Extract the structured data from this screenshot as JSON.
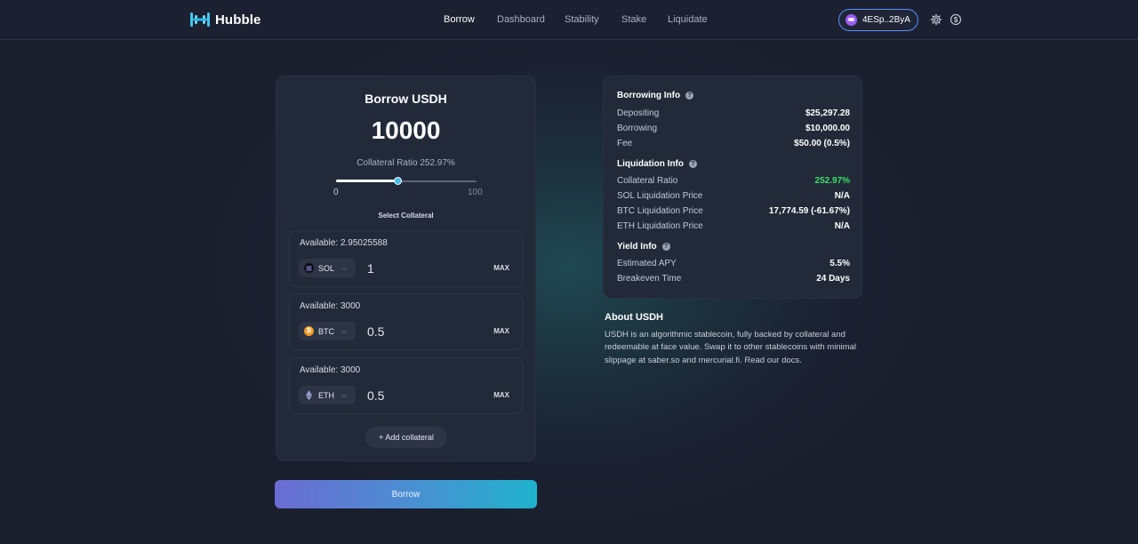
{
  "header": {
    "logo_text": "Hubble",
    "nav": [
      {
        "label": "Borrow",
        "active": true
      },
      {
        "label": "Dashboard",
        "active": false
      },
      {
        "label": "Stability",
        "active": false
      },
      {
        "label": "Stake",
        "active": false
      },
      {
        "label": "Liquidate",
        "active": false
      }
    ],
    "wallet": "4ESp..2ByA",
    "icons": [
      "gear-icon",
      "dollar-icon"
    ]
  },
  "borrow": {
    "title": "Borrow USDH",
    "amount": "10000",
    "ratio_label": "Collateral Ratio 252.97%",
    "slider": {
      "min_label": "0",
      "max_label": "100",
      "value": 44
    },
    "select_collateral": "Select Collateral",
    "collaterals": [
      {
        "available": "Available: 2.95025588",
        "token": "SOL",
        "value": "1",
        "max": "MAX",
        "icon": "solana-icon"
      },
      {
        "available": "Available: 3000",
        "token": "BTC",
        "value": "0.5",
        "max": "MAX",
        "icon": "bitcoin-icon"
      },
      {
        "available": "Available: 3000",
        "token": "ETH",
        "value": "0.5",
        "max": "MAX",
        "icon": "ethereum-icon"
      }
    ],
    "add_collateral": "+ Add collateral",
    "borrow_button": "Borrow"
  },
  "info": {
    "borrowing": {
      "title": "Borrowing Info",
      "rows": [
        {
          "label": "Depositing",
          "value": "$25,297.28"
        },
        {
          "label": "Borrowing",
          "value": "$10,000.00"
        },
        {
          "label": "Fee",
          "value": "$50.00 (0.5%)"
        }
      ]
    },
    "liquidation": {
      "title": "Liquidation Info",
      "rows": [
        {
          "label": "Collateral Ratio",
          "value": "252.97%"
        },
        {
          "label": "SOL Liquidation Price",
          "value": "N/A"
        },
        {
          "label": "BTC Liquidation Price",
          "value": "17,774.59 (-61.67%)"
        },
        {
          "label": "ETH Liquidation Price",
          "value": "N/A"
        }
      ]
    },
    "yield": {
      "title": "Yield Info",
      "rows": [
        {
          "label": "Estimated APY",
          "value": "5.5%"
        },
        {
          "label": "Breakeven Time",
          "value": "24 Days"
        }
      ]
    }
  },
  "about": {
    "title": "About USDH",
    "text": "USDH is an algorithmic stablecoin, fully backed by collateral and redeemable at face value. Swap it to other stablecoins with minimal slippage at saber.so and mercurial.fi. Read our docs."
  },
  "colors": {
    "accent_green": "#3ee06a",
    "slider_thumb": "#4ab8ee",
    "wallet_border": "#5b8cff",
    "button_gradient_start": "#6a6cd2",
    "button_gradient_end": "#1fb2cc"
  }
}
